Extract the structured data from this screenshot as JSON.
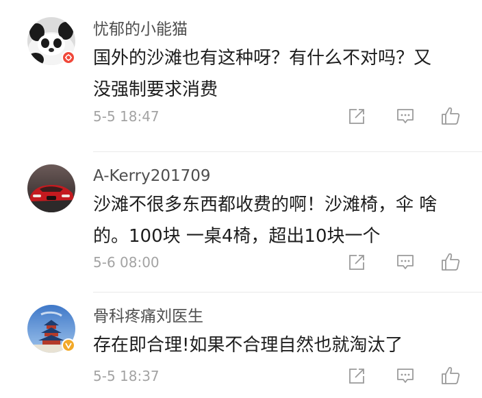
{
  "comments": [
    {
      "username": "忧郁的小能猫",
      "text_line1": "国外的沙滩也有这种呀？有什么不对吗？又",
      "text_line2": "没强制要求消费",
      "time": "5-5 18:47",
      "avatar_icon": "panda-avatar",
      "badge_icon": "red-verified-badge-icon"
    },
    {
      "username": "A-Kerry201709",
      "text_line1": "沙滩不很多东西都收费的啊！沙滩椅，伞 啥",
      "text_line2": "的。100块 一桌4椅，超出10块一个",
      "time": "5-6 08:00",
      "avatar_icon": "red-car-avatar"
    },
    {
      "username": "骨科疼痛刘医生",
      "text_line1": "存在即合理!如果不合理自然也就淘汰了",
      "time": "5-5 18:37",
      "avatar_icon": "temple-of-heaven-avatar",
      "badge_icon": "gold-verified-badge-icon"
    }
  ],
  "colors": {
    "username": "#4e4e4e",
    "text": "#1d1d1d",
    "time": "#a3a3a3",
    "icon": "#9a9a9a",
    "badge_red": "#f0483a",
    "badge_gold": "#f2a929"
  },
  "action_icons": [
    "share-icon",
    "comment-icon",
    "like-icon"
  ]
}
